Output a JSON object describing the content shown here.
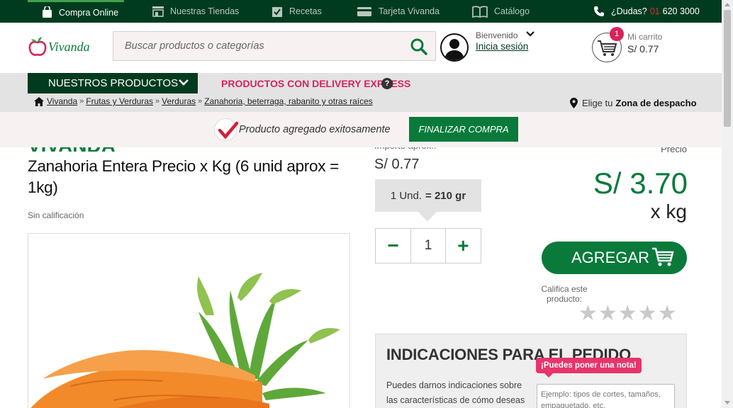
{
  "topbar": {
    "items": [
      {
        "label": "Compra Online",
        "icon": "shopping-bag-icon",
        "active": true
      },
      {
        "label": "Nuestras Tiendas",
        "icon": "store-icon"
      },
      {
        "label": "Recetas",
        "icon": "recipe-icon"
      },
      {
        "label": "Tarjeta Vivanda",
        "icon": "card-icon"
      },
      {
        "label": "Catálogo",
        "icon": "book-icon"
      }
    ],
    "phone_prefix": "¿Dudas?",
    "phone_area": "01",
    "phone_number": "620 3000"
  },
  "header": {
    "logo_text": "Vivanda",
    "search_placeholder": "Buscar productos o categorías",
    "welcome": "Bienvenido",
    "login": "Inicia sesión",
    "cart_label": "Mi carrito",
    "cart_total": "S/ 0.77",
    "cart_count": "1"
  },
  "nav": {
    "products": "NUESTROS PRODUCTOS",
    "delivery": "PRODUCTOS CON DELIVERY EXPRESS",
    "help": "?",
    "breadcrumbs": [
      "Vivanda",
      "Frutas y Verduras",
      "Verduras",
      "Zanahoria, beterraga, rabanito y otras raíces"
    ],
    "zone_prefix": "Elige tu",
    "zone": "Zona de despacho"
  },
  "added": {
    "message": "Producto agregado exitosamente",
    "finalize": "FINALIZAR COMPRA"
  },
  "product": {
    "brand": "VIVANDA",
    "title": "Zanahoria Entera Precio x Kg (6 unid aprox = 1kg)",
    "rating_text": "Sin calificación",
    "importe_label": "Importe aprox.:",
    "importe_value": "S/ 0.77",
    "unit_label": "1 Und.",
    "unit_weight": "= 210 gr",
    "qty_minus": "−",
    "qty_value": "1",
    "qty_plus": "+",
    "price_label": "Precio",
    "price": "S/ 3.70",
    "per": "x kg",
    "add": "AGREGAR",
    "rate_label": "Califica este producto:",
    "stars": [
      "★",
      "★",
      "★",
      "★",
      "★"
    ]
  },
  "indications": {
    "title": "INDICACIONES PARA EL PEDIDO",
    "text": "Puedes darnos indicaciones sobre las características de cómo deseas",
    "note_tag": "¡Puedes poner una nota!",
    "placeholder": "Ejemplo: tipos de cortes, tamaños, empaquetado, etc."
  },
  "colors": {
    "dark_green": "#003b1f",
    "green": "#0a7a3b",
    "pink": "#d6245b"
  }
}
